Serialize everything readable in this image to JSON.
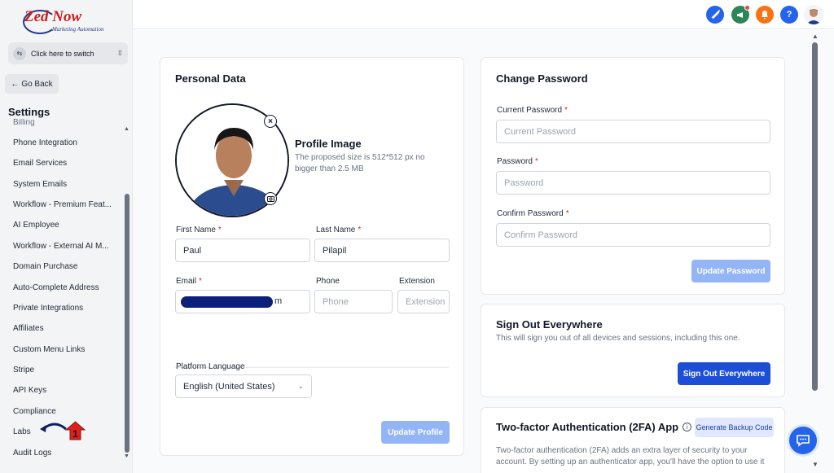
{
  "app": {
    "logo_main": "Zed Now",
    "logo_sub": "Marketing Automation"
  },
  "switcher": {
    "label": "Click here to switch"
  },
  "sidebar": {
    "back_label": "Go Back",
    "section_title": "Settings",
    "partial_item": "Billing",
    "items": [
      "Phone Integration",
      "Email Services",
      "System Emails",
      "Workflow - Premium Feat...",
      "AI Employee",
      "Workflow - External AI M...",
      "Domain Purchase",
      "Auto-Complete Address",
      "Private Integrations",
      "Affiliates",
      "Custom Menu Links",
      "Stripe",
      "API Keys",
      "Compliance",
      "Labs",
      "Audit Logs"
    ],
    "callout_number": "1"
  },
  "header": {
    "icons": [
      "rocket-icon",
      "megaphone-icon",
      "bell-icon",
      "help-icon"
    ],
    "help_label": "?"
  },
  "personal_data": {
    "title": "Personal Data",
    "profile_image_title": "Profile Image",
    "profile_image_hint": "The proposed size is 512*512 px no bigger than 2.5 MB",
    "first_name_label": "First Name",
    "first_name_value": "Paul",
    "last_name_label": "Last Name",
    "last_name_value": "Pilapil",
    "email_label": "Email",
    "email_visible_tail": "m",
    "phone_label": "Phone",
    "phone_placeholder": "Phone",
    "extension_label": "Extension",
    "extension_placeholder": "Extension",
    "language_label": "Platform Language",
    "language_value": "English (United States)",
    "update_button": "Update Profile",
    "required_mark": "*"
  },
  "change_password": {
    "title": "Change Password",
    "current_label": "Current Password",
    "current_placeholder": "Current Password",
    "password_label": "Password",
    "password_placeholder": "Password",
    "confirm_label": "Confirm Password",
    "confirm_placeholder": "Confirm Password",
    "update_button": "Update Password",
    "required_mark": "*"
  },
  "sign_out": {
    "title": "Sign Out Everywhere",
    "description": "This will sign you out of all devices and sessions, including this one.",
    "button": "Sign Out Everywhere"
  },
  "two_factor": {
    "title": "Two-factor Authentication (2FA) App",
    "backup_button": "Generate Backup Code",
    "description": "Two-factor authentication (2FA) adds an extra layer of security to your account. By setting up an authenticator app, you'll have the option to use it"
  },
  "colors": {
    "primary": "#1d4ed8",
    "primary_disabled": "#93b4f5",
    "required": "#dc2626",
    "brand_red": "#c81e1e"
  }
}
